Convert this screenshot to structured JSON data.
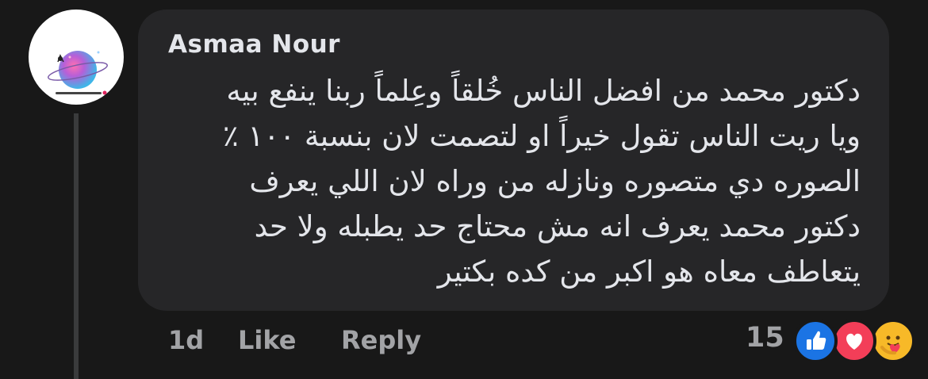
{
  "comment": {
    "author": "Asmaa Nour",
    "lines": [
      "دكتور محمد من افضل الناس خُلقاً وعِلماً ربنا ينفع بيه",
      "ويا ريت الناس تقول خيراً او لتصمت لان بنسبة ١٠٠ ٪",
      "الصوره دي متصوره ونازله من وراه لان اللي يعرف",
      "دكتور محمد يعرف انه مش محتاج حد يطبله ولا حد",
      "يتعاطف معاه هو اكبر من كده بكتير"
    ],
    "timestamp": "1d",
    "like_label": "Like",
    "reply_label": "Reply",
    "reaction_count": "15",
    "reactions": [
      "like-icon",
      "love-icon",
      "care-icon"
    ]
  },
  "colors": {
    "background": "#181818",
    "bubble": "#262628",
    "like_blue": "#1b74e4",
    "love_red": "#f33e58",
    "care_yellow": "#f7b928"
  }
}
